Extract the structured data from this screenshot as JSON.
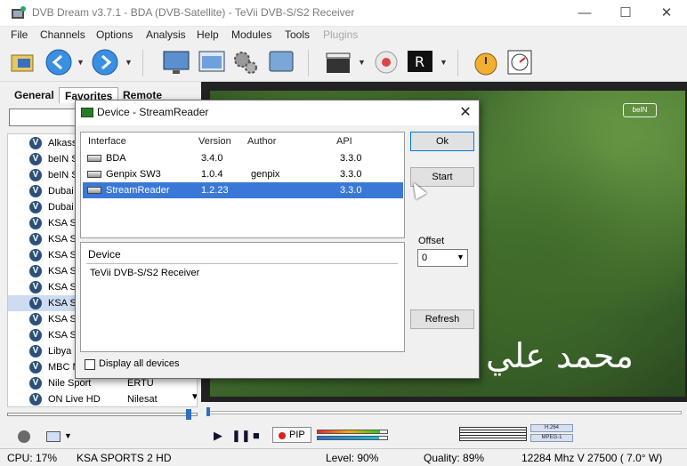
{
  "window": {
    "title": "DVB Dream v3.7.1 - BDA (DVB-Satellite) - TeVii DVB-S/S2 Receiver",
    "minimize": "—",
    "maximize": "☐",
    "close": "✕"
  },
  "menu": [
    "File",
    "Channels",
    "Options",
    "Analysis",
    "Help",
    "Modules",
    "Tools",
    "Plugins"
  ],
  "toolbar": {
    "icons": [
      "open-file-icon",
      "back-icon",
      "forward-icon",
      "monitor-icon",
      "screen-window-icon",
      "settings-gears-icon",
      "fullscreen-icon",
      "clapper-icon",
      "record-disk-icon",
      "recording-R-icon",
      "stopwatch-icon",
      "epg-icon"
    ]
  },
  "left_panel": {
    "tabs": [
      "General",
      "Favorites",
      "Remote"
    ],
    "active_tab": "Favorites",
    "channels": [
      {
        "name": "Alkass",
        "sat": ""
      },
      {
        "name": "beIN SP",
        "sat": ""
      },
      {
        "name": "beIN SP",
        "sat": ""
      },
      {
        "name": "Dubai S",
        "sat": ""
      },
      {
        "name": "Dubai S",
        "sat": ""
      },
      {
        "name": "KSA Spo",
        "sat": ""
      },
      {
        "name": "KSA Spo",
        "sat": ""
      },
      {
        "name": "KSA Spo",
        "sat": ""
      },
      {
        "name": "KSA SP",
        "sat": ""
      },
      {
        "name": "KSA Sp",
        "sat": ""
      },
      {
        "name": "KSA SP",
        "sat": ""
      },
      {
        "name": "KSA Sp",
        "sat": ""
      },
      {
        "name": "KSA SP",
        "sat": ""
      },
      {
        "name": "Libya S",
        "sat": ""
      },
      {
        "name": "MBC M",
        "sat": ""
      },
      {
        "name": "Nile Sport",
        "sat": "ERTU"
      },
      {
        "name": "ON Live HD",
        "sat": "Nilesat"
      }
    ],
    "selected_index": 10
  },
  "video": {
    "channel_logo": "beIN",
    "watermark": "محمد علي"
  },
  "controls": {
    "play": "▶",
    "pause": "❚❚",
    "stop": "■",
    "pip": "PIP",
    "codec_video": "H.264",
    "codec_audio": "MPEG-1",
    "signal_level": 0.9,
    "signal_quality": 0.89
  },
  "statusbar": {
    "cpu": "CPU: 17%",
    "channel": "KSA SPORTS 2 HD",
    "level": "Level: 90%",
    "quality": "Quality: 89%",
    "tuning": "12284 Mhz  V  27500  ( 7.0° W)"
  },
  "dialog": {
    "title": "Device - StreamReader",
    "close": "✕",
    "columns": [
      "Interface",
      "Version",
      "Author",
      "API"
    ],
    "rows": [
      {
        "interface": "BDA",
        "version": "3.4.0",
        "author": "",
        "api": "3.3.0"
      },
      {
        "interface": "Genpix SW3",
        "version": "1.0.4",
        "author": "genpix",
        "api": "3.3.0"
      },
      {
        "interface": "StreamReader",
        "version": "1.2.23",
        "author": "",
        "api": "3.3.0"
      }
    ],
    "selected_row": 2,
    "device_label": "Device",
    "device_value": "TeVii DVB-S/S2 Receiver",
    "display_all": "Display all devices",
    "ok_button": "Ok",
    "start_button": "Start",
    "offset_label": "Offset",
    "offset_value": "0",
    "refresh_button": "Refresh"
  },
  "colors": {
    "selection": "#3a78d8",
    "accent": "#0078d7"
  }
}
